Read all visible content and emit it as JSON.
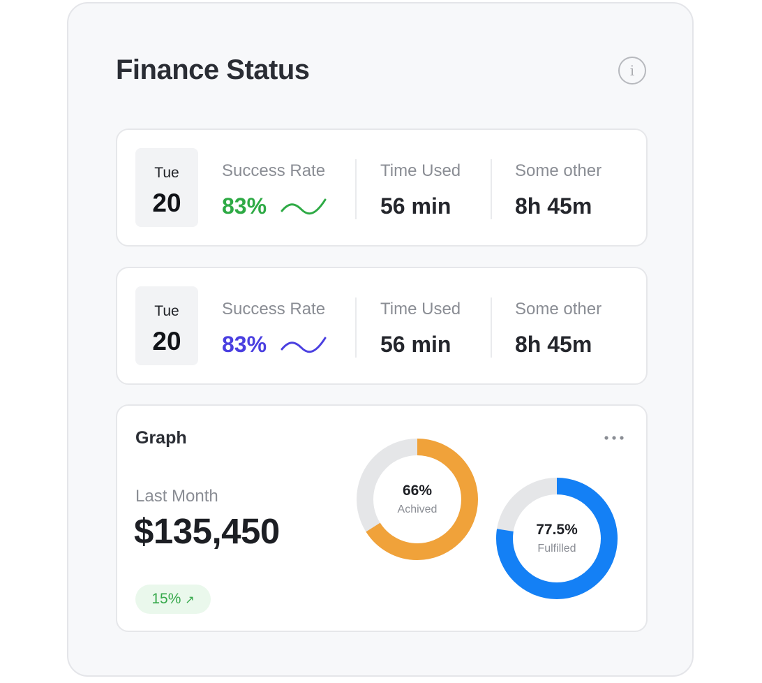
{
  "title": "Finance Status",
  "info_icon": "info-icon",
  "cards": [
    {
      "day": "Tue",
      "date": "20",
      "success_label": "Success Rate",
      "success_value": "83%",
      "accent": "#2eaa45",
      "time_label": "Time Used",
      "time_value": "56 min",
      "other_label": "Some other",
      "other_value": "8h 45m"
    },
    {
      "day": "Tue",
      "date": "20",
      "success_label": "Success Rate",
      "success_value": "83%",
      "accent": "#4a3fe0",
      "time_label": "Time Used",
      "time_value": "56 min",
      "other_label": "Some other",
      "other_value": "8h 45m"
    }
  ],
  "graph": {
    "title": "Graph",
    "more_icon": "more-horizontal-icon",
    "last_month_label": "Last Month",
    "amount": "$135,450",
    "trend": "15%",
    "trend_icon": "arrow-up-right-icon",
    "trend_color": "#35a84a",
    "donuts": [
      {
        "percent": "66%",
        "value": 0.66,
        "caption": "Achived",
        "color": "#f0a23a",
        "track": "#e5e6e8"
      },
      {
        "percent": "77.5%",
        "value": 0.775,
        "caption": "Fulfilled",
        "color": "#1480f5",
        "track": "#e5e6e8"
      }
    ]
  }
}
